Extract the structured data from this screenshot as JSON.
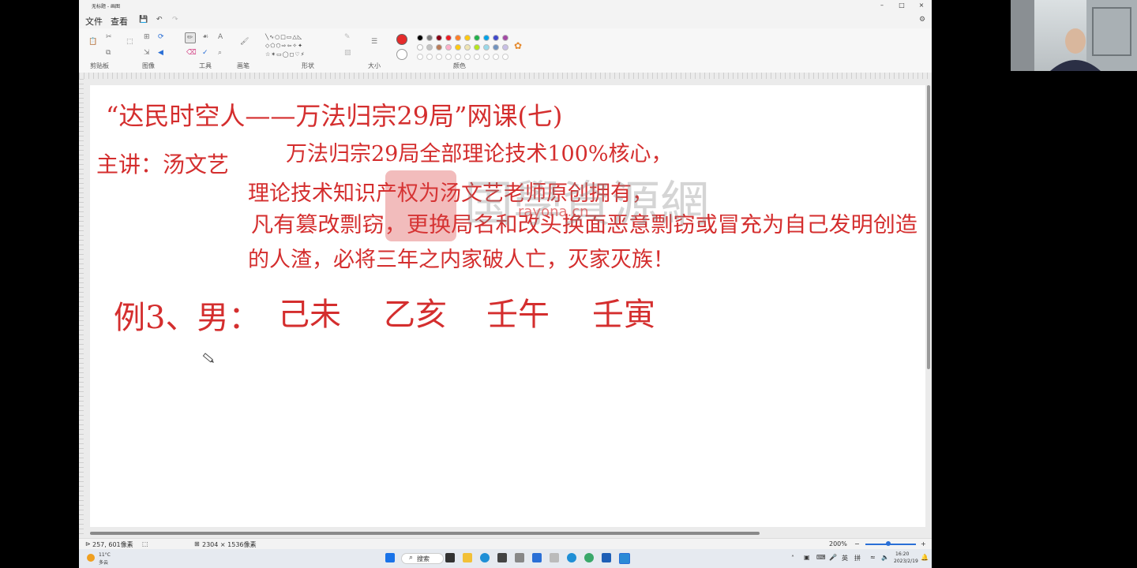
{
  "window": {
    "title": "无标题 - 画图",
    "controls": {
      "minimize": "–",
      "maximize": "□",
      "close": "×"
    }
  },
  "menu": {
    "items": [
      "文件",
      "查看"
    ]
  },
  "ribbon": {
    "groups": {
      "clipboard": "剪贴板",
      "image": "图像",
      "tools": "工具",
      "brushes": "画笔",
      "shapes": "形状",
      "size": "大小",
      "colors": "颜色"
    },
    "primary_color": "#e52b2b",
    "secondary_color": "#ffffff",
    "palette_row1": [
      "#000000",
      "#7f7f7f",
      "#880015",
      "#ed1c24",
      "#ff7f27",
      "#ffc90e",
      "#22b14c",
      "#00a2e8",
      "#3f48cc",
      "#a349a4"
    ],
    "palette_row2": [
      "#ffffff",
      "#c3c3c3",
      "#b97a57",
      "#ffaec9",
      "#ffc90e",
      "#efe4b0",
      "#b5e61d",
      "#99d9ea",
      "#7092be",
      "#c8bfe7"
    ]
  },
  "canvas": {
    "handwriting": {
      "line1": "“达民时空人——万法归宗29局”网课(七)",
      "line2_label": "主讲：汤文艺",
      "line2": "万法归宗29局全部理论技术100%核心，",
      "line3": "理论技术知识产权为汤文艺老师原创拥有，",
      "line4": "凡有篡改剽窃，更换局名和改头换面恶意剽窃或冒充为自己发明创造",
      "line5": "的人渣，必将三年之内家破人亡，灭家灭族！",
      "example_label": "例3、男：",
      "pillars": [
        "己未",
        "乙亥",
        "壬午",
        "壬寅"
      ]
    },
    "watermark_text": "国學資源網",
    "watermark_url": "rayona.cn"
  },
  "status": {
    "cursor_pos": "257, 601像素",
    "canvas_size": "2304 × 1536像素",
    "zoom": "200%",
    "zoom_minus": "−",
    "zoom_plus": "+"
  },
  "taskbar": {
    "weather_temp": "11°C",
    "weather_text": "多云",
    "search_label": "搜索",
    "ime_lang": "英",
    "ime_mode": "拼",
    "time": "16:20",
    "date": "2023/2/19"
  }
}
